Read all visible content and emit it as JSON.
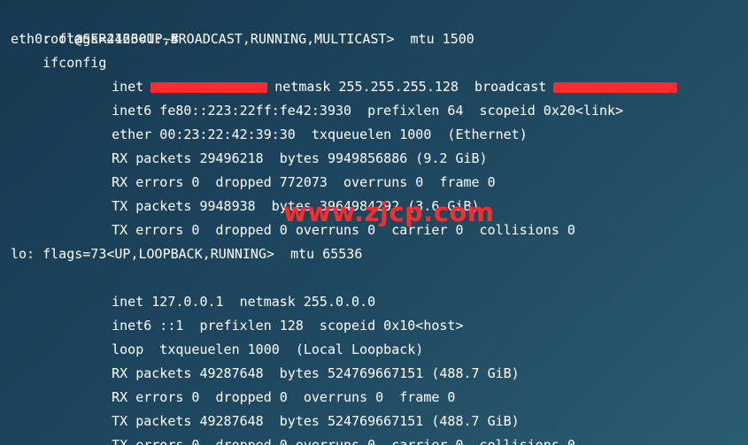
{
  "prompt": "root@SER242601:~#",
  "command": "ifconfig",
  "lines": [
    "eth0: flags=4163<UP,BROADCAST,RUNNING,MULTICAST>  mtu 1500",
    "inet",
    "netmask 255.255.255.128",
    "broadcast",
    "inet6 fe80::223:22ff:fe42:3930  prefixlen 64  scopeid 0x20<link>",
    "ether 00:23:22:42:39:30  txqueuelen 1000  (Ethernet)",
    "RX packets 29496218  bytes 9949856886 (9.2 GiB)",
    "RX errors 0  dropped 772073  overruns 0  frame 0",
    "TX packets 9948938  bytes 3964984292 (3.6 GiB)",
    "TX errors 0  dropped 0 overruns 0  carrier 0  collisions 0",
    "lo: flags=73<UP,LOOPBACK,RUNNING>  mtu 65536",
    "inet 127.0.0.1  netmask 255.0.0.0",
    "inet6 ::1  prefixlen 128  scopeid 0x10<host>",
    "loop  txqueuelen 1000  (Local Loopback)",
    "RX packets 49287648  bytes 524769667151 (488.7 GiB)",
    "RX errors 0  dropped 0  overruns 0  frame 0",
    "TX packets 49287648  bytes 524769667151 (488.7 GiB)",
    "TX errors 0  dropped 0 overruns 0  carrier 0  collisions 0"
  ],
  "watermark": "www.zjcp.com",
  "colors": {
    "text": "#ffffff",
    "redaction": "#ff2a2a",
    "background_start": "#173851",
    "background_end": "#2b5d72"
  }
}
